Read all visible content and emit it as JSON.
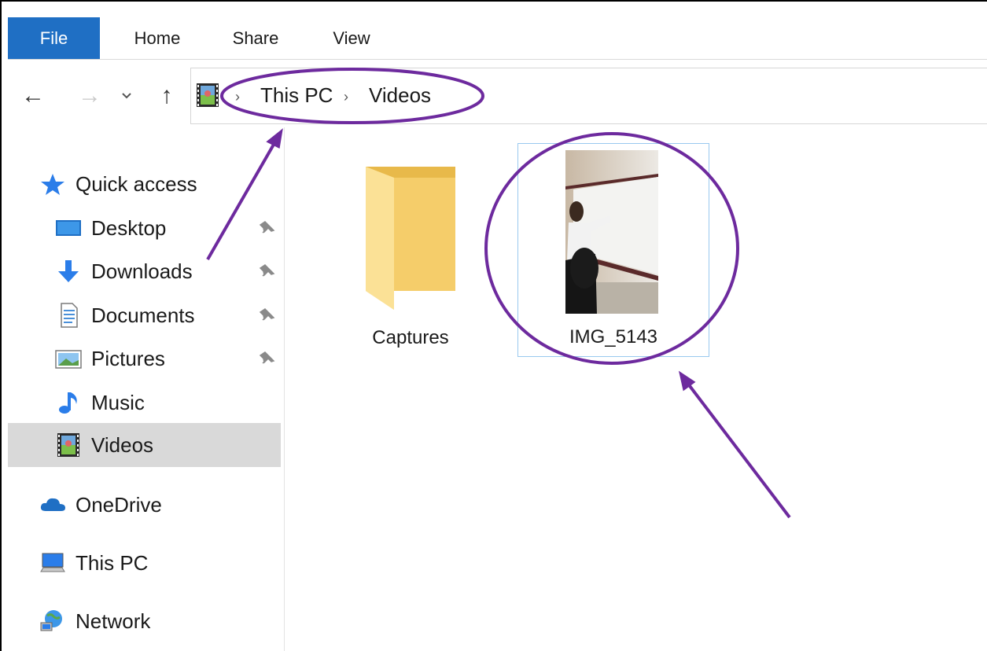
{
  "ribbon": {
    "tabs": [
      {
        "label": "File"
      },
      {
        "label": "Home"
      },
      {
        "label": "Share"
      },
      {
        "label": "View"
      }
    ]
  },
  "nav": {
    "back_glyph": "←",
    "forward_glyph": "→",
    "recent_glyph": "⌄",
    "up_glyph": "↑"
  },
  "address": {
    "crumbs": [
      "This PC",
      "Videos"
    ],
    "separator": "›"
  },
  "sidebar": {
    "quick_access": "Quick access",
    "items": [
      {
        "label": "Desktop",
        "icon": "desktop-icon",
        "pinned": true
      },
      {
        "label": "Downloads",
        "icon": "downloads-icon",
        "pinned": true
      },
      {
        "label": "Documents",
        "icon": "documents-icon",
        "pinned": true
      },
      {
        "label": "Pictures",
        "icon": "pictures-icon",
        "pinned": true
      },
      {
        "label": "Music",
        "icon": "music-icon",
        "pinned": false
      },
      {
        "label": "Videos",
        "icon": "videos-icon",
        "pinned": false
      }
    ],
    "onedrive": "OneDrive",
    "this_pc": "This PC",
    "network": "Network",
    "selected": "Videos"
  },
  "content": {
    "items": [
      {
        "name": "Captures",
        "type": "folder",
        "icon": "folder-icon"
      },
      {
        "name": "IMG_5143",
        "type": "video",
        "icon": "video-thumbnail"
      }
    ],
    "selected": "IMG_5143"
  },
  "colors": {
    "accent": "#1f6fc4",
    "annotation": "#6d2a9e",
    "selection_border": "#99c9ef",
    "selected_nav": "#d9d9d9"
  }
}
